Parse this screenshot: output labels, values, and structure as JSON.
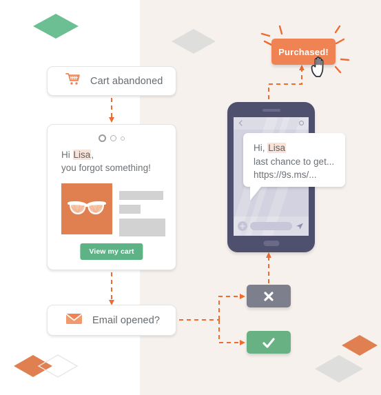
{
  "theme": {
    "orange": "#ef8354",
    "orange_dark": "#e07f4f",
    "green": "#5db385",
    "green_btn": "#67b183",
    "green_diamond": "#6cbf92",
    "grey_btn": "#7d7f8c",
    "bg_left": "#ffffff",
    "bg_right": "#f7f1ee",
    "phone_body": "#4f4f6e",
    "phone_screen": "#d3d2e0",
    "text_grey": "#6c7176",
    "highlight": "#fbe2d6",
    "placeholder_grey": "#d2d2d2",
    "diamond_grey": "#dededd"
  },
  "flow": {
    "trigger": {
      "label": "Cart abandoned",
      "icon": "shopping-cart-icon"
    },
    "email_preview": {
      "window_dots": [
        "large",
        "medium",
        "small"
      ],
      "greeting_line1_prefix": "Hi ",
      "greeting_name": "Lisa",
      "greeting_line1_suffix": ",",
      "greeting_line2": "you forgot something!",
      "hero_image_alt": "sunglasses-product-image",
      "placeholder_bars": [
        "wide",
        "short",
        "block"
      ],
      "cta_label": "View my cart"
    },
    "decision": {
      "label": "Email opened?",
      "icon": "envelope-icon"
    },
    "outcomes": [
      {
        "id": "no",
        "icon": "cross-icon",
        "glyph": "✕",
        "color": "#7d7f8c"
      },
      {
        "id": "yes",
        "icon": "check-icon",
        "glyph": "✓",
        "color": "#67b183"
      }
    ]
  },
  "sms": {
    "phone": {
      "back_icon": "chevron-left-icon",
      "settings_icon": "gear-icon",
      "attach_icon": "plus-icon",
      "send_icon": "send-icon",
      "home_button": "home-indicator"
    },
    "bubble": {
      "line1_prefix": "Hi, ",
      "line1_name": "Lisa",
      "line2": "last chance to get...",
      "line3": "https://9s.ms/..."
    }
  },
  "conversion": {
    "badge_label": "Purchased!",
    "cursor_icon": "pointing-hand-cursor",
    "burst_icon": "celebration-burst-icon"
  },
  "decorations": [
    {
      "name": "diamond-green-top-left",
      "color": "#6cbf92",
      "fill": true
    },
    {
      "name": "diamond-grey-top-right",
      "color": "#dededd",
      "fill": true
    },
    {
      "name": "diamond-orange-bottom-left",
      "color": "#e07f4f",
      "fill": true
    },
    {
      "name": "diamond-outline-bottom-left",
      "color": "#e8e8e8",
      "fill": false
    },
    {
      "name": "diamond-grey-bottom-right",
      "color": "#dededd",
      "fill": true
    },
    {
      "name": "diamond-orange-bottom-right",
      "color": "#e07f4f",
      "fill": true
    }
  ]
}
